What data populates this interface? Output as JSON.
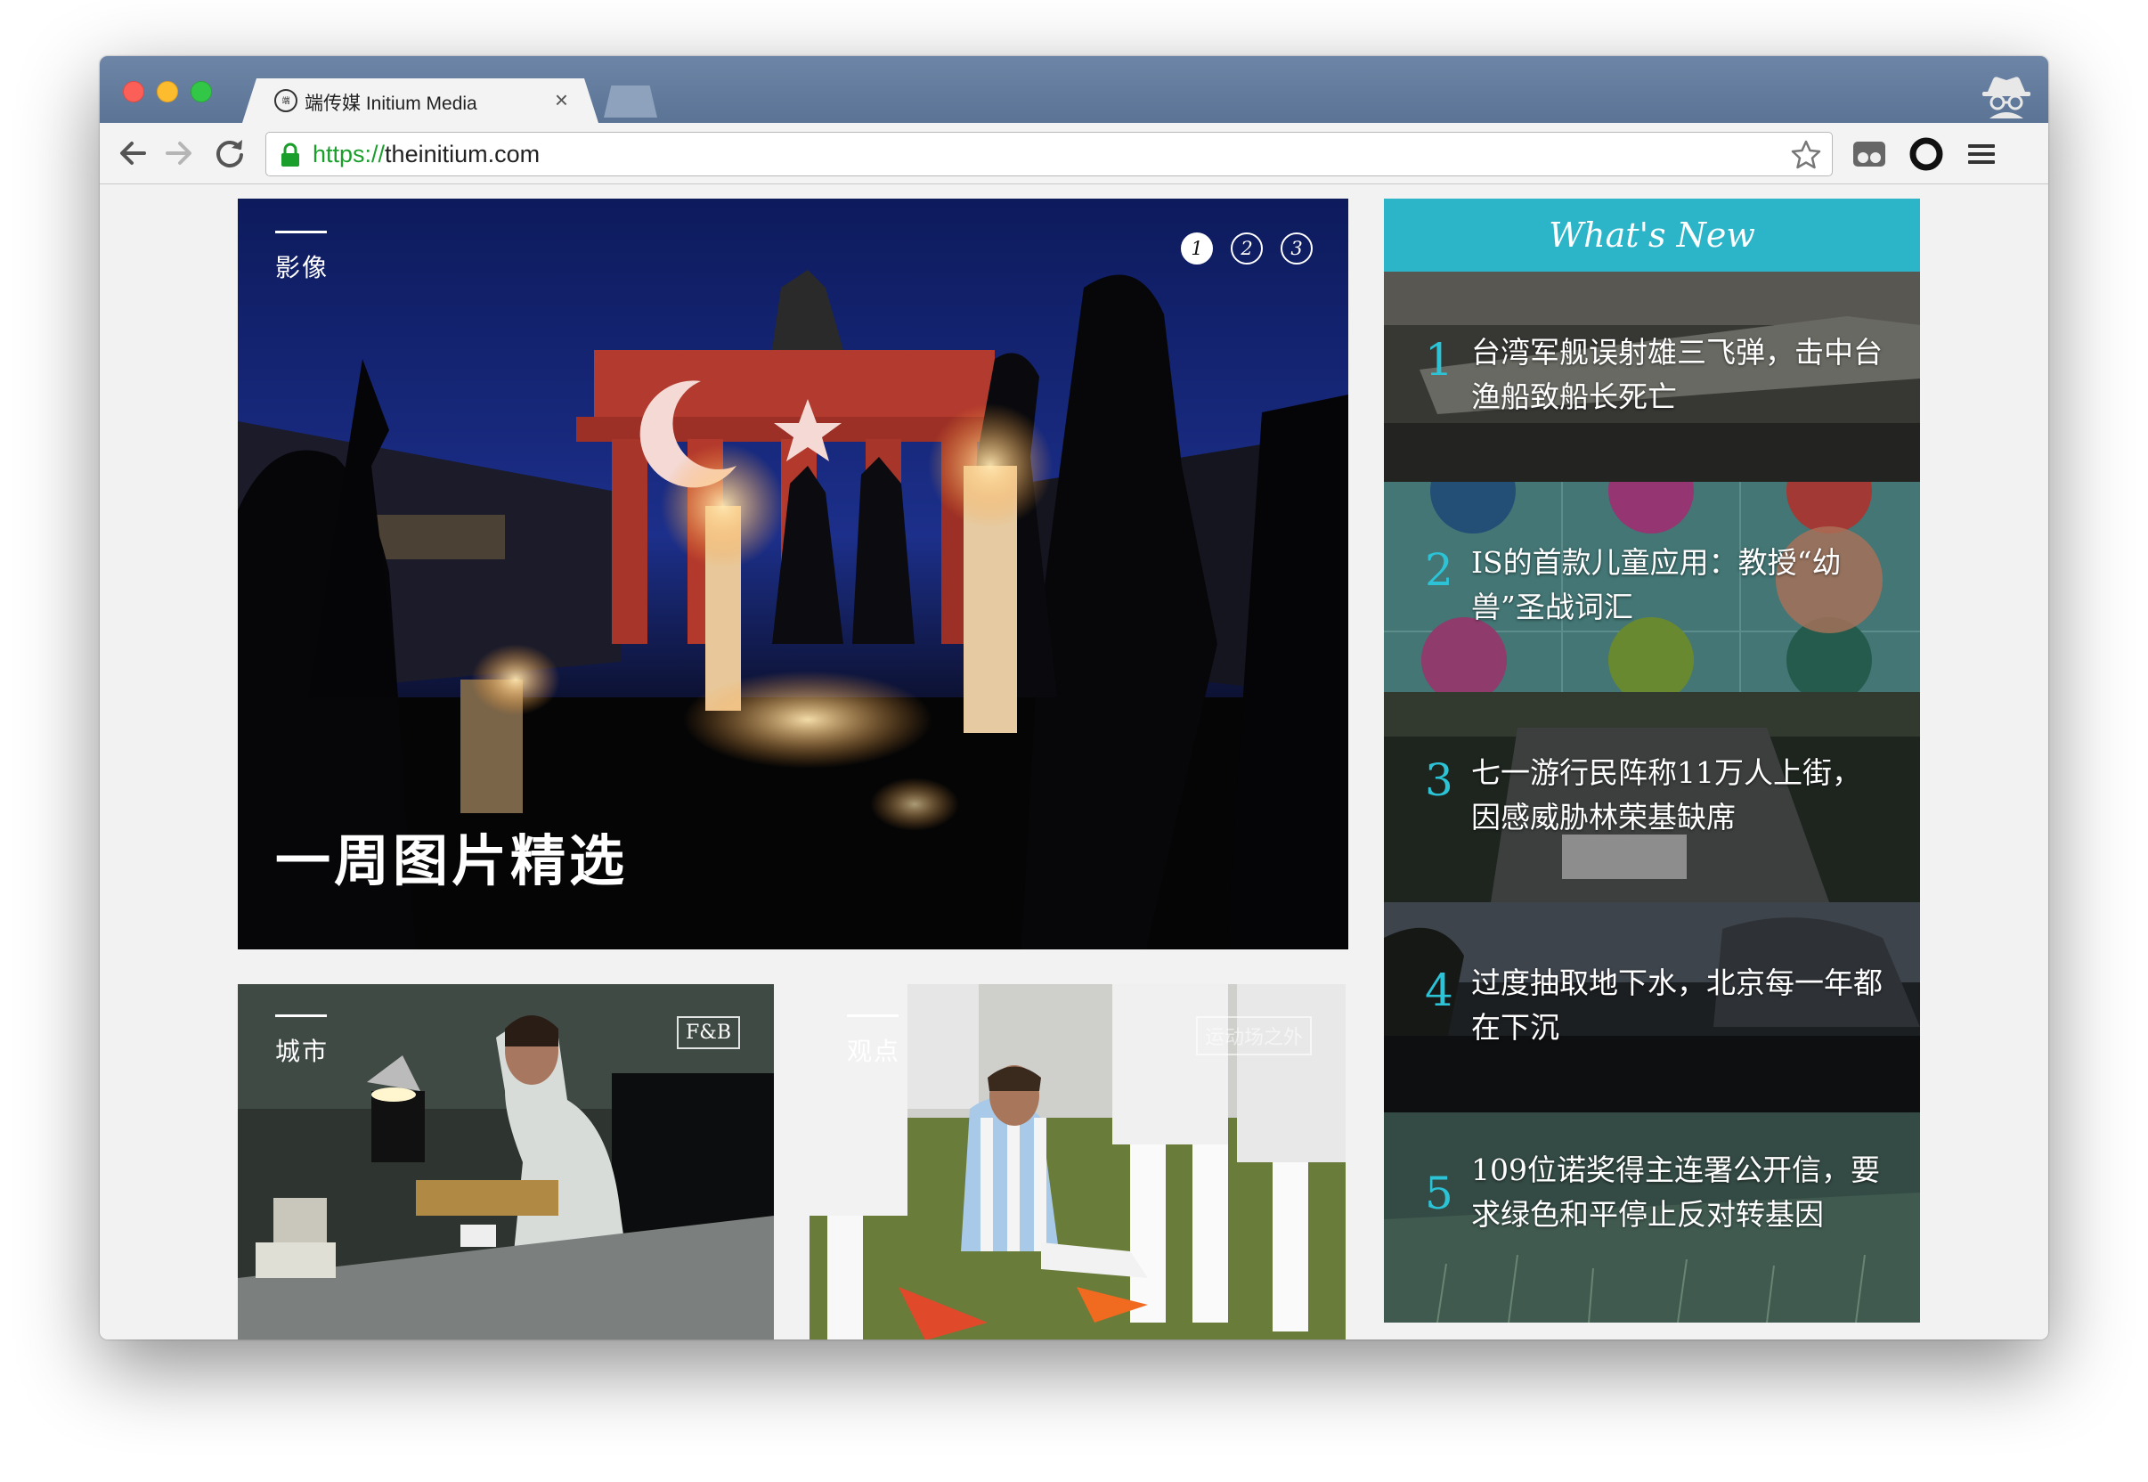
{
  "browser": {
    "tab_title": "端传媒 Initium Media",
    "tab_favicon": "端",
    "tab_close": "×",
    "url_scheme": "https://",
    "url_host": "theinitium.com"
  },
  "hero": {
    "section": "影像",
    "title": "一周图片精选",
    "slides": [
      "1",
      "2",
      "3"
    ],
    "active_slide": 1
  },
  "cards": [
    {
      "section": "城市",
      "badge": "F&B"
    },
    {
      "section": "观点",
      "badge": "运动场之外"
    }
  ],
  "whats_new": {
    "heading": "What's New",
    "accent_color": "#2cb5c8",
    "items": [
      {
        "num": "1",
        "text": "台湾军舰误射雄三飞弹，击中台渔船致船长死亡"
      },
      {
        "num": "2",
        "text": "IS的首款儿童应用：教授“幼兽”圣战词汇"
      },
      {
        "num": "3",
        "text": "七一游行民阵称11万人上街，因感威胁林荣基缺席"
      },
      {
        "num": "4",
        "text": "过度抽取地下水，北京每一年都在下沉"
      },
      {
        "num": "5",
        "text": "109位诺奖得主连署公开信，要求绿色和平停止反对转基因"
      }
    ]
  },
  "icons": {
    "back": "arrow-left-icon",
    "forward": "arrow-right-icon",
    "reload": "reload-icon",
    "secure": "lock-icon",
    "bookmark": "star-icon",
    "incognito": "incognito-icon",
    "menu": "hamburger-menu-icon"
  }
}
